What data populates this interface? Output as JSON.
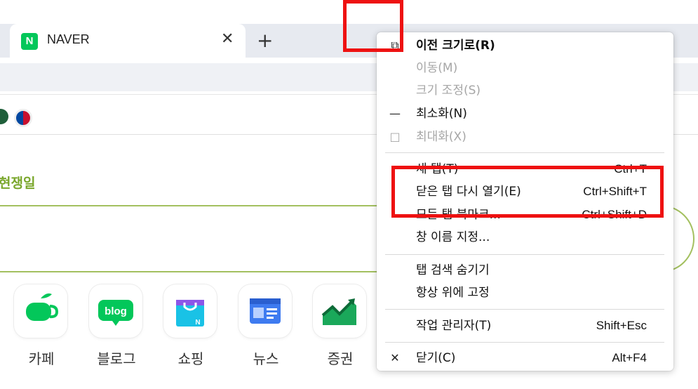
{
  "browser": {
    "tab_title": "NAVER",
    "favicon_letter": "N",
    "close_glyph": "✕",
    "new_tab_glyph": "+"
  },
  "page": {
    "holiday_text": "현쟁일",
    "services": [
      {
        "label": "카페",
        "icon": "cafe-cup-icon"
      },
      {
        "label": "블로그",
        "icon": "blog-bubble-icon"
      },
      {
        "label": "쇼핑",
        "icon": "shopping-bag-icon"
      },
      {
        "label": "뉴스",
        "icon": "news-icon"
      },
      {
        "label": "증권",
        "icon": "stock-chart-icon"
      }
    ],
    "blog_icon_text": "blog",
    "shopping_icon_letter": "N"
  },
  "menu": {
    "items": [
      {
        "label": "이전 크기로(R)",
        "icon": "restore-icon",
        "glyph": "⧉",
        "shortcut": "",
        "disabled": false,
        "bold": true
      },
      {
        "label": "이동(M)",
        "icon": "",
        "glyph": "",
        "shortcut": "",
        "disabled": true,
        "bold": false
      },
      {
        "label": "크기 조정(S)",
        "icon": "",
        "glyph": "",
        "shortcut": "",
        "disabled": true,
        "bold": false
      },
      {
        "label": "최소화(N)",
        "icon": "minimize-icon",
        "glyph": "—",
        "shortcut": "",
        "disabled": false,
        "bold": false
      },
      {
        "label": "최대화(X)",
        "icon": "maximize-icon",
        "glyph": "□",
        "shortcut": "",
        "disabled": true,
        "bold": false
      },
      {
        "label": "새 탭(T)",
        "icon": "",
        "glyph": "",
        "shortcut": "Ctrl+T",
        "disabled": false,
        "bold": false
      },
      {
        "label": "닫은 탭 다시 열기(E)",
        "icon": "",
        "glyph": "",
        "shortcut": "Ctrl+Shift+T",
        "disabled": false,
        "bold": false
      },
      {
        "label": "모든 탭 북마크...",
        "icon": "",
        "glyph": "",
        "shortcut": "Ctrl+Shift+D",
        "disabled": false,
        "bold": false
      },
      {
        "label": "창 이름 지정...",
        "icon": "",
        "glyph": "",
        "shortcut": "",
        "disabled": false,
        "bold": false
      },
      {
        "label": "탭 검색 숨기기",
        "icon": "",
        "glyph": "",
        "shortcut": "",
        "disabled": false,
        "bold": false
      },
      {
        "label": "항상 위에 고정",
        "icon": "",
        "glyph": "",
        "shortcut": "",
        "disabled": false,
        "bold": false
      },
      {
        "label": "작업 관리자(T)",
        "icon": "",
        "glyph": "",
        "shortcut": "Shift+Esc",
        "disabled": false,
        "bold": false
      },
      {
        "label": "닫기(C)",
        "icon": "close-icon",
        "glyph": "✕",
        "shortcut": "Alt+F4",
        "disabled": false,
        "bold": false
      }
    ]
  },
  "colors": {
    "naver_green": "#03c75a",
    "highlight_red": "#ee1111",
    "disabled_text": "#a6a6a6"
  }
}
